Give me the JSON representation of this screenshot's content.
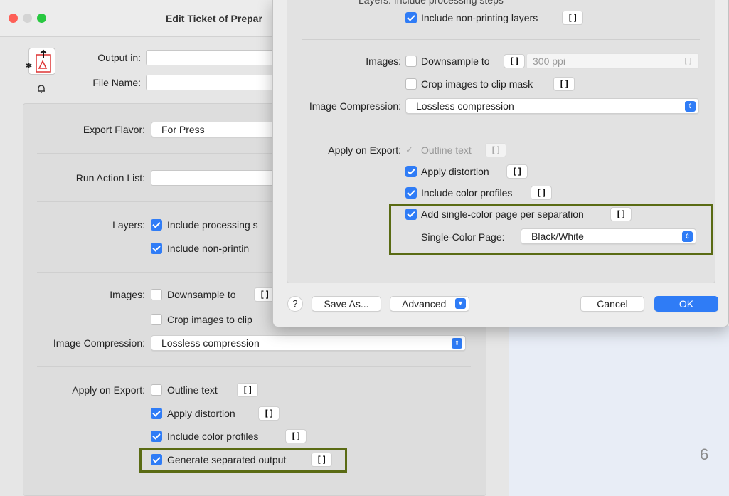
{
  "back_window": {
    "title": "Edit Ticket of Prepar",
    "output_label": "Output in:",
    "filename_label": "File Name:",
    "export_flavor_label": "Export Flavor:",
    "export_flavor_value": "For Press",
    "run_action_label": "Run Action List:",
    "layers_label": "Layers:",
    "layers_opt1": "Include processing s",
    "layers_opt2": "Include non-printin",
    "images_label": "Images:",
    "downsample": "Downsample to",
    "crop": "Crop images to clip",
    "compression_label": "Image Compression:",
    "compression_value": "Lossless compression",
    "apply_label": "Apply on Export:",
    "outline": "Outline text",
    "distortion": "Apply distortion",
    "color_profiles": "Include color profiles",
    "separated": "Generate separated output",
    "var_btn": "[]"
  },
  "front_window": {
    "partial_top": "Layers: Include processing steps",
    "non_printing": "Include non-printing layers",
    "images_label": "Images:",
    "downsample": "Downsample to",
    "ppi": "300 ppi",
    "ppi_var": "[]",
    "crop": "Crop images to clip mask",
    "compression_label": "Image Compression:",
    "compression_value": "Lossless compression",
    "apply_label": "Apply on Export:",
    "outline": "Outline text",
    "distortion": "Apply distortion",
    "color_profiles": "Include color profiles",
    "single_color": "Add single-color page per separation",
    "single_color_page_label": "Single-Color Page:",
    "single_color_page_value": "Black/White",
    "help": "?",
    "save_as": "Save As...",
    "advanced": "Advanced",
    "cancel": "Cancel",
    "ok": "OK",
    "var_btn": "[]"
  },
  "slide_page_number": "6",
  "colors": {
    "accent": "#2f7cf6",
    "highlight": "#5a6b14",
    "traffic_red": "#fe5f57",
    "traffic_yellow": "#febc2e",
    "traffic_green": "#28c840"
  }
}
